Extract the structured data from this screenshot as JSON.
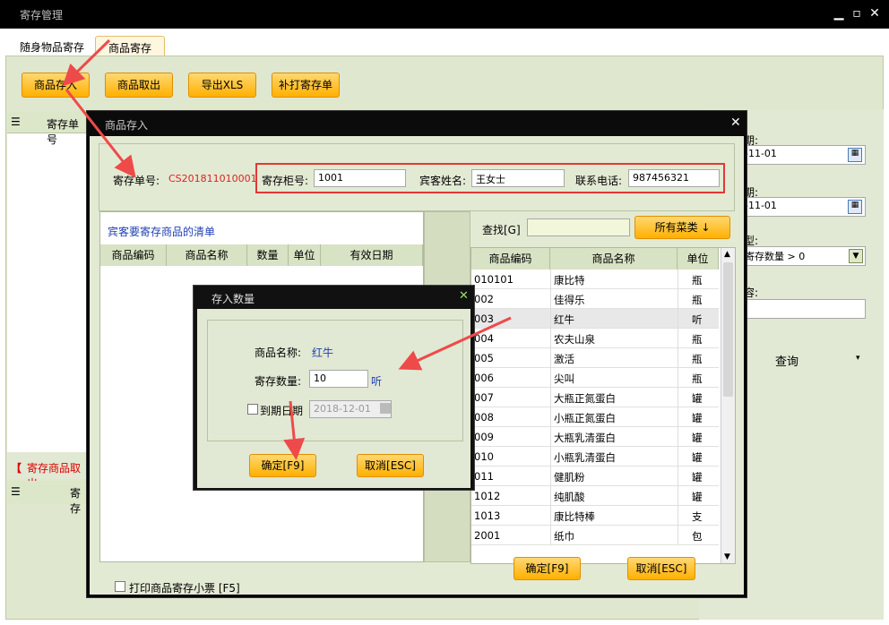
{
  "window": {
    "title": "寄存管理",
    "min_icon": "minimize-icon",
    "max_icon": "maximize-icon",
    "close_icon": "close-icon"
  },
  "tabs": [
    {
      "label": "随身物品寄存",
      "active": false
    },
    {
      "label": "商品寄存",
      "active": true
    }
  ],
  "toolbar": {
    "store": "商品存入",
    "take": "商品取出",
    "export": "导出XLS",
    "reprint": "补打寄存单"
  },
  "left_grid": {
    "col_deposit_no": "寄存单号",
    "section_title": "寄存商品取出",
    "col2": "寄存"
  },
  "right_panel": {
    "date1_label": "期:",
    "date1_value": "-11-01",
    "date2_label": "期:",
    "date2_value": "-11-01",
    "type_label": "型:",
    "type_value": "寄存数量 > 0",
    "content_label": "容:",
    "query": "查询"
  },
  "dialog": {
    "title": "商品存入",
    "deposit_no_label": "寄存单号:",
    "deposit_no": "CS201811010001",
    "locker_label": "寄存柜号:",
    "locker_value": "1001",
    "guest_label": "宾客姓名:",
    "guest_value": "王女士",
    "phone_label": "联系电话:",
    "phone_value": "987456321",
    "list_title": "宾客要寄存商品的清单",
    "list_cols": [
      "商品编码",
      "商品名称",
      "数量",
      "单位",
      "有效日期"
    ],
    "search_label": "查找[G]",
    "search_value": "",
    "category_btn": "所有菜类 ↓",
    "product_cols": [
      "商品编码",
      "商品名称",
      "单位"
    ],
    "products": [
      {
        "code": "010101",
        "name": "康比特",
        "unit": "瓶"
      },
      {
        "code": "002",
        "name": "佳得乐",
        "unit": "瓶"
      },
      {
        "code": "003",
        "name": "红牛",
        "unit": "听"
      },
      {
        "code": "004",
        "name": "农夫山泉",
        "unit": "瓶"
      },
      {
        "code": "005",
        "name": "激活",
        "unit": "瓶"
      },
      {
        "code": "006",
        "name": "尖叫",
        "unit": "瓶"
      },
      {
        "code": "007",
        "name": "大瓶正氮蛋白",
        "unit": "罐"
      },
      {
        "code": "008",
        "name": "小瓶正氮蛋白",
        "unit": "罐"
      },
      {
        "code": "009",
        "name": "大瓶乳清蛋白",
        "unit": "罐"
      },
      {
        "code": "010",
        "name": "小瓶乳清蛋白",
        "unit": "罐"
      },
      {
        "code": "011",
        "name": "健肌粉",
        "unit": "罐"
      },
      {
        "code": "1012",
        "name": "纯肌酸",
        "unit": "罐"
      },
      {
        "code": "1013",
        "name": "康比特棒",
        "unit": "支"
      },
      {
        "code": "2001",
        "name": "纸巾",
        "unit": "包"
      }
    ],
    "print_label": "打印商品寄存小票 [F5]",
    "ok": "确定[F9]",
    "cancel": "取消[ESC]"
  },
  "qty_dialog": {
    "title": "存入数量",
    "name_label": "商品名称:",
    "name_value": "红牛",
    "qty_label": "寄存数量:",
    "qty_value": "10",
    "unit": "听",
    "expire_label": "到期日期",
    "expire_value": "2018-12-01",
    "ok": "确定[F9]",
    "cancel": "取消[ESC]"
  }
}
